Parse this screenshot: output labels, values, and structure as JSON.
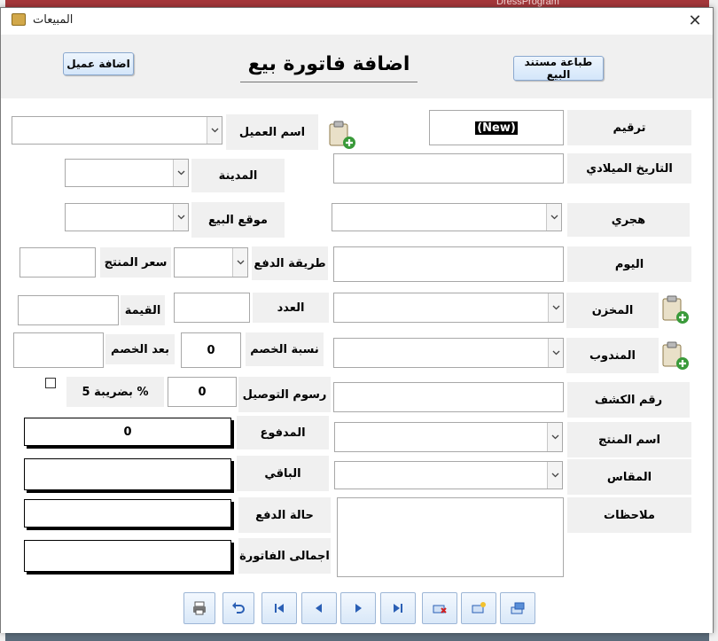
{
  "background": {
    "app_name": "DressProgram"
  },
  "window": {
    "title": "المبيعات",
    "close_glyph": "✕"
  },
  "header": {
    "add_client_button": "اضافة عميل",
    "form_title": "اضافة فاتورة بيع",
    "print_document_button": "طباعة مستند البيع"
  },
  "right_fields": {
    "number_label": "ترقيم",
    "number_value": "(New)",
    "gregorian_date_label": "التاريخ الميلادي",
    "gregorian_date_value": "",
    "hijri_label": "هجري",
    "hijri_value": "",
    "day_label": "اليوم",
    "day_value": "",
    "warehouse_label": "المخزن",
    "warehouse_value": "",
    "representative_label": "المندوب",
    "representative_value": "",
    "statement_number_label": "رقم الكشف",
    "statement_number_value": "",
    "product_name_label": "اسم المنتج",
    "product_name_value": "",
    "size_label": "المقاس",
    "size_value": "",
    "notes_label": "ملاحظات",
    "notes_value": ""
  },
  "left_fields": {
    "client_name_label": "اسم العميل",
    "client_name_value": "",
    "city_label": "المدينة",
    "city_value": "",
    "sale_location_label": "موقع البيع",
    "sale_location_value": "",
    "payment_method_label": "طريقة الدفع",
    "payment_method_value": "",
    "product_price_label": "سعر المنتج",
    "product_price_value": "",
    "quantity_label": "العدد",
    "quantity_value": "",
    "value_label": "القيمة",
    "value_value": "",
    "discount_rate_label": "نسبة الخصم",
    "discount_rate_value": "0",
    "after_discount_label": "بعد الخصم",
    "after_discount_value": "",
    "delivery_fee_label": "رسوم التوصيل",
    "delivery_fee_value": "0",
    "tax_label": "بضريبة 5 %",
    "tax_checked": false,
    "paid_label": "المدفوع",
    "paid_value": "0",
    "remaining_label": "الباقي",
    "remaining_value": "",
    "payment_status_label": "حالة الدفع",
    "payment_status_value": "",
    "invoice_total_label": "اجمالى الفاتورة",
    "invoice_total_value": ""
  },
  "toolbar": {
    "icons": [
      "print-icon",
      "undo-icon",
      "first-record-icon",
      "previous-record-icon",
      "next-record-icon",
      "last-record-icon",
      "delete-record-icon",
      "new-record-icon",
      "save-record-icon"
    ]
  },
  "colors": {
    "label_bg": "#f0f0f0",
    "button_bg": "#dbe9fa",
    "accent_green": "#3a9a3a"
  }
}
